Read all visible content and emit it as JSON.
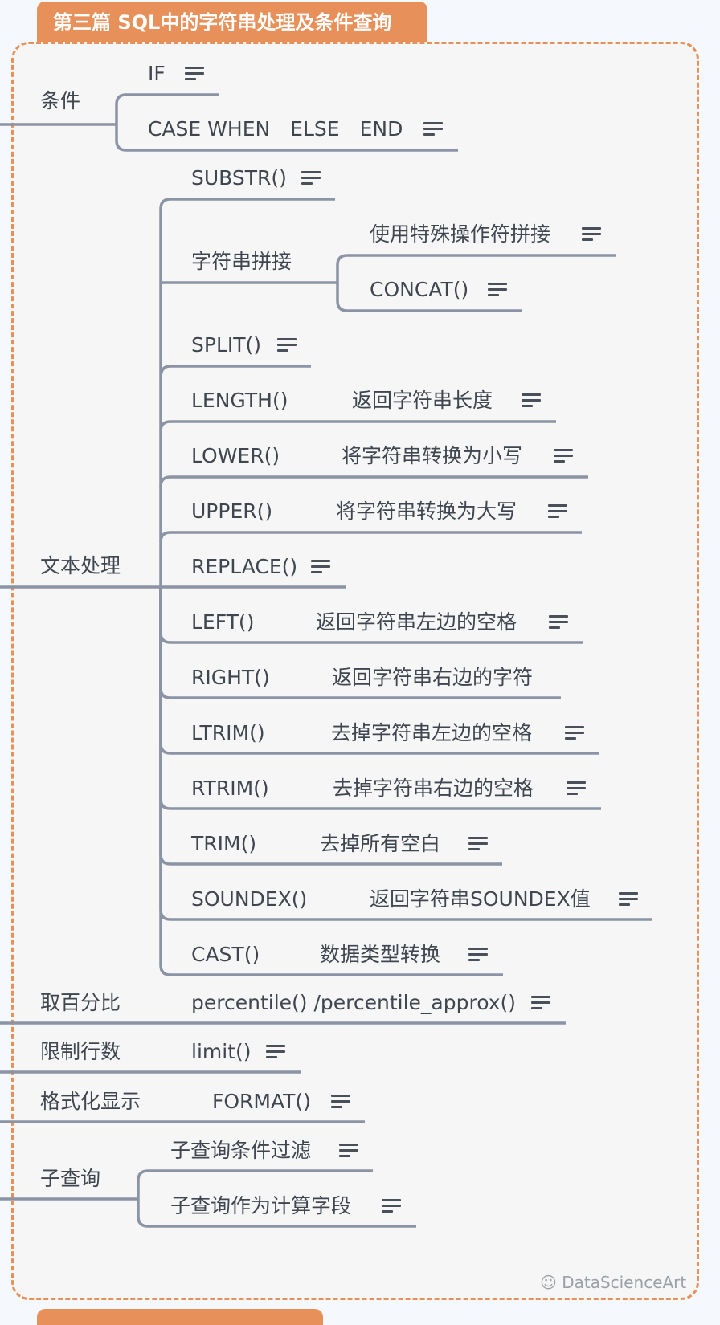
{
  "title": "第三篇 SQL中的字符串处理及条件查询",
  "watermark": "DataScienceArt",
  "nodes": {
    "cond": "条件",
    "if": "IF",
    "casewhen": "CASE WHEN　ELSE　END",
    "text": "文本处理",
    "substr": "SUBSTR()",
    "concat_group": "字符串拼接",
    "special": "使用特殊操作符拼接",
    "concat": "CONCAT()",
    "split": "SPLIT()",
    "length": "LENGTH()",
    "length_d": "返回字符串长度",
    "lower": "LOWER()",
    "lower_d": "将字符串转换为小写",
    "upper": "UPPER()",
    "upper_d": "将字符串转换为大写",
    "replace": "REPLACE()",
    "left": "LEFT()",
    "left_d": "返回字符串左边的空格",
    "right": "RIGHT()",
    "right_d": "返回字符串右边的字符",
    "ltrim": "LTRIM()",
    "ltrim_d": "去掉字符串左边的空格",
    "rtrim": "RTRIM()",
    "rtrim_d": "去掉字符串右边的空格",
    "trim": "TRIM()",
    "trim_d": "去掉所有空白",
    "soundex": "SOUNDEX()",
    "soundex_d": "返回字符串SOUNDEX值",
    "cast": "CAST()",
    "cast_d": "数据类型转换",
    "pct": "取百分比",
    "pct_f": "percentile() /percentile_approx()",
    "limit": "限制行数",
    "limit_f": "limit()",
    "fmt": "格式化显示",
    "fmt_f": "FORMAT()",
    "sub": "子查询",
    "sub1": "子查询条件过滤",
    "sub2": "子查询作为计算字段"
  }
}
